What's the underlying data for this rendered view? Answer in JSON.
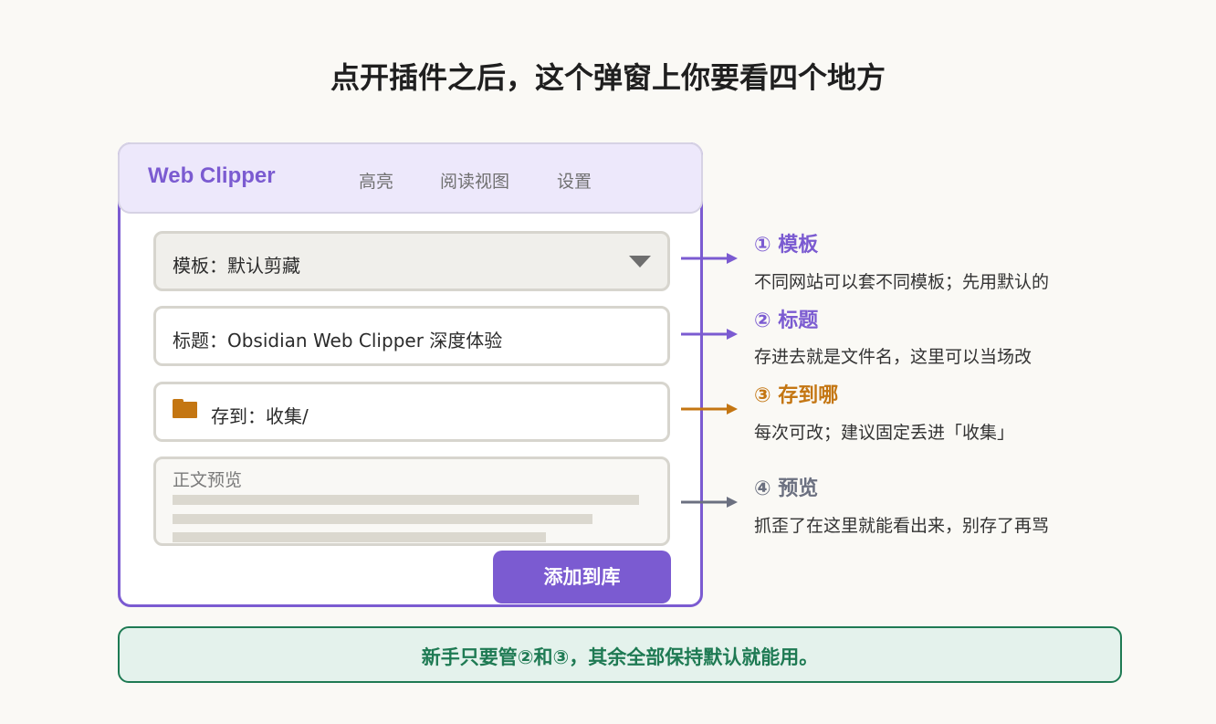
{
  "page": {
    "title": "点开插件之后，这个弹窗上你要看四个地方"
  },
  "popup": {
    "brand": "Web Clipper",
    "tabs": [
      "高亮",
      "阅读视图",
      "设置"
    ],
    "template_field": "模板：默认剪藏",
    "title_field": "标题：Obsidian Web Clipper 深度体验",
    "save_field": "存到：收集/",
    "preview_label": "正文预览",
    "add_button": "添加到库"
  },
  "callouts": [
    {
      "title": "① 模板",
      "desc": "不同网站可以套不同模板；先用默认的",
      "color": "#7b5bd1"
    },
    {
      "title": "② 标题",
      "desc": "存进去就是文件名，这里可以当场改",
      "color": "#7b5bd1"
    },
    {
      "title": "③ 存到哪",
      "desc": "每次可改；建议固定丢进「收集」",
      "color": "#c47612"
    },
    {
      "title": "④ 预览",
      "desc": "抓歪了在这里就能看出来，别存了再骂",
      "color": "#6b7080"
    }
  ],
  "tip": "新手只要管②和③，其余全部保持默认就能用。",
  "colors": {
    "accent": "#7b5bd1",
    "folder": "#c47612",
    "preview": "#6b7080",
    "tip": "#1e7a53"
  }
}
